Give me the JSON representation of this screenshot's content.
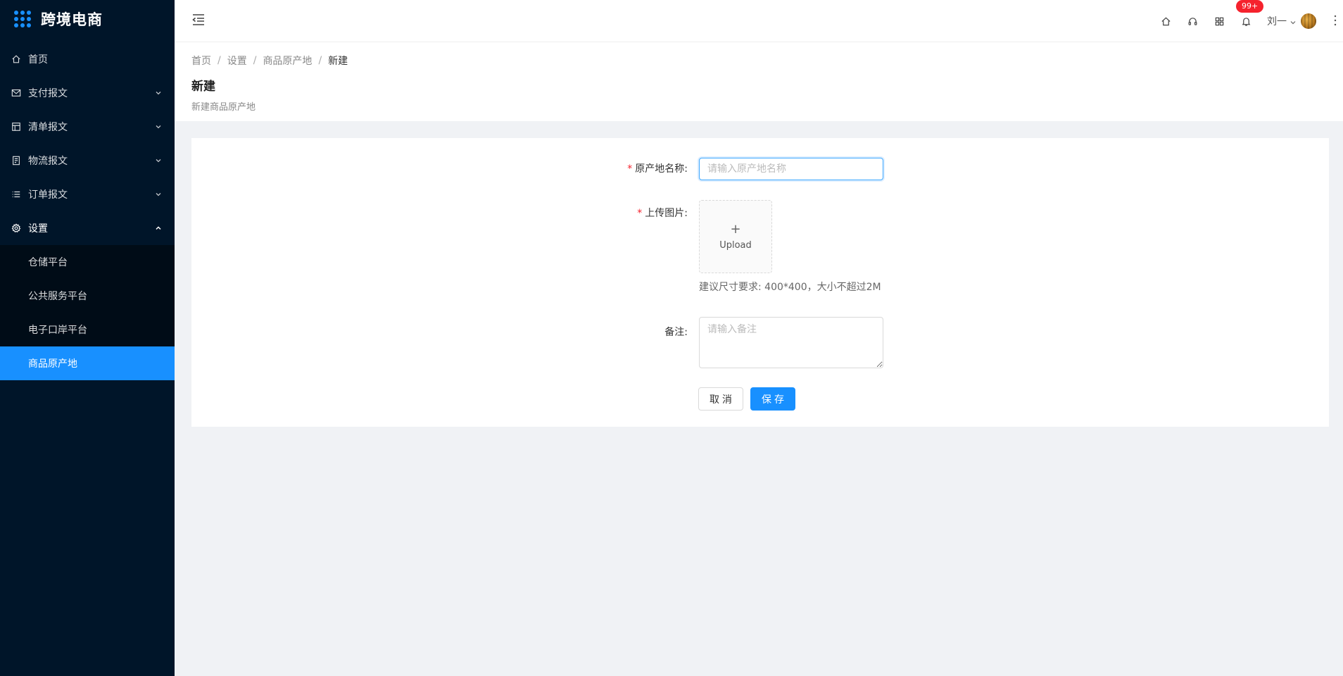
{
  "app": {
    "title": "跨境电商"
  },
  "sidebar": {
    "items": [
      {
        "label": "首页",
        "icon": "home-icon"
      },
      {
        "label": "支付报文",
        "icon": "mail-icon"
      },
      {
        "label": "清单报文",
        "icon": "table-icon"
      },
      {
        "label": "物流报文",
        "icon": "container-icon"
      },
      {
        "label": "订单报文",
        "icon": "list-icon"
      },
      {
        "label": "设置",
        "icon": "gear-icon"
      }
    ],
    "submenu": [
      {
        "label": "仓储平台"
      },
      {
        "label": "公共服务平台"
      },
      {
        "label": "电子口岸平台"
      },
      {
        "label": "商品原产地"
      }
    ],
    "active_item": "商品原产地"
  },
  "header": {
    "notification_badge": "99+",
    "user_name": "刘一"
  },
  "breadcrumb": [
    "首页",
    "设置",
    "商品原产地",
    "新建"
  ],
  "page": {
    "title": "新建",
    "subtitle": "新建商品原产地"
  },
  "form": {
    "origin_name_label": "原产地名称:",
    "origin_name_placeholder": "请输入原产地名称",
    "image_label": "上传图片:",
    "upload_plus": "+",
    "upload_text": "Upload",
    "upload_hint": "建议尺寸要求: 400*400，大小不超过2M",
    "remark_label": "备注:",
    "remark_placeholder": "请输入备注",
    "required_mark": "*",
    "cancel_label": "取消",
    "save_label": "保存"
  },
  "colors": {
    "sidebar_bg": "#001529",
    "accent": "#1890ff",
    "badge": "#f5222d"
  }
}
